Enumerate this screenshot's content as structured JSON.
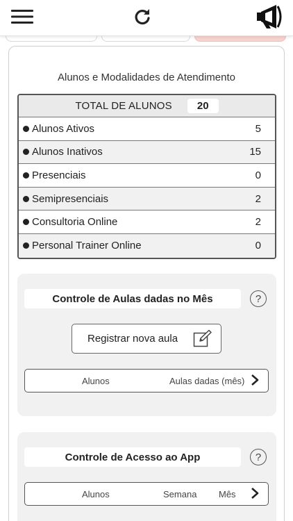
{
  "topbar": {
    "menu_icon": "hamburger-menu-icon",
    "refresh_icon": "refresh-icon",
    "announce_icon": "megaphone-icon"
  },
  "summary": {
    "title": "Alunos e Modalidades de Atendimento",
    "total_label": "TOTAL DE ALUNOS",
    "total_value": "20",
    "rows": [
      {
        "label": "Alunos Ativos",
        "value": "5"
      },
      {
        "label": "Alunos Inativos",
        "value": "15"
      },
      {
        "label": "Presenciais",
        "value": "0"
      },
      {
        "label": "Semipresenciais",
        "value": "2"
      },
      {
        "label": "Consultoria Online",
        "value": "2"
      },
      {
        "label": "Personal Trainer Online",
        "value": "0"
      }
    ]
  },
  "aulas": {
    "title": "Controle de Aulas dadas no Mês",
    "help": "?",
    "register_label": "Registrar nova aula",
    "col_students": "Alunos",
    "col_classes": "Aulas dadas (mês)"
  },
  "app_access": {
    "title": "Controle de Acesso ao App",
    "help": "?",
    "col_students": "Alunos",
    "col_week": "Semana",
    "col_month": "Mês"
  }
}
